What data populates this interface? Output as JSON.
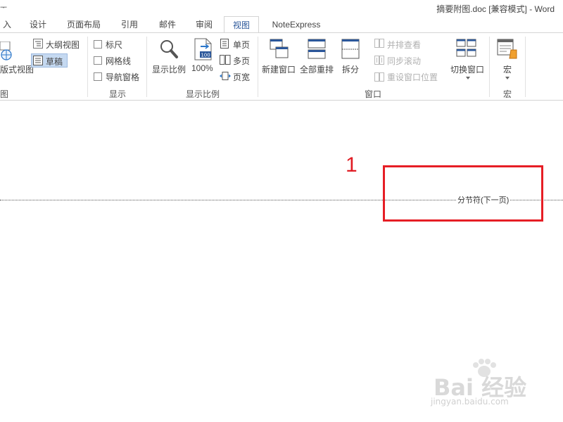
{
  "window": {
    "title": "摘要附图.doc [兼容模式] - Word",
    "left_cut_char": "ᅮ"
  },
  "tabs": [
    {
      "label": "入",
      "active": false
    },
    {
      "label": "设计",
      "active": false
    },
    {
      "label": "页面布局",
      "active": false
    },
    {
      "label": "引用",
      "active": false
    },
    {
      "label": "邮件",
      "active": false
    },
    {
      "label": "审阅",
      "active": false
    },
    {
      "label": "视图",
      "active": true
    },
    {
      "label": "NoteExpress",
      "active": false
    }
  ],
  "ribbon": {
    "views": {
      "web_layout_label": "版式视图",
      "outline_label": "大纲视图",
      "draft_label": "草稿",
      "group_label": "图"
    },
    "show": {
      "ruler_label": "标尺",
      "gridlines_label": "网格线",
      "nav_pane_label": "导航窗格",
      "group_label": "显示"
    },
    "zoom": {
      "zoom_label": "显示比例",
      "percent_label": "100%",
      "icon_text": "100",
      "one_page_label": "单页",
      "multi_page_label": "多页",
      "page_width_label": "页宽",
      "group_label": "显示比例"
    },
    "window": {
      "new_window_label": "新建窗口",
      "arrange_all_label": "全部重排",
      "split_label": "拆分",
      "side_by_side_label": "并排查看",
      "sync_scroll_label": "同步滚动",
      "reset_pos_label": "重设窗口位置",
      "switch_window_label": "切换窗口",
      "group_label": "窗口"
    },
    "macros": {
      "macros_label": "宏",
      "group_label": "宏"
    }
  },
  "document": {
    "section_break_label": "分节符(下一页)",
    "annotation_number": "1"
  },
  "watermark": {
    "logo_text": "Bai 经验",
    "url_text": "jingyan.baidu.com"
  },
  "colors": {
    "accent": "#2b579a",
    "annotation_red": "#e61e25",
    "selected_bg": "#c5d9f1"
  }
}
